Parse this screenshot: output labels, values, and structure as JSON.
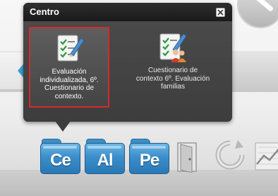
{
  "popup": {
    "title": "Centro",
    "close_icon": "close-icon",
    "options": [
      {
        "label": "Evaluación individualizada, 6º. Cuestionario de contexto.",
        "icon": "checklist-pencil-icon",
        "selected": true
      },
      {
        "label": "Cuestionario de contexto 6º. Evaluación familias",
        "icon": "checklist-family-icon",
        "selected": false
      }
    ]
  },
  "dock": {
    "items": [
      {
        "label": "Ce",
        "icon": "folder-icon"
      },
      {
        "label": "Al",
        "icon": "folder-icon"
      },
      {
        "label": "Pe",
        "icon": "folder-icon"
      },
      {
        "icon": "door-exit-icon"
      },
      {
        "icon": "refresh-icon"
      },
      {
        "icon": "line-chart-icon"
      }
    ]
  },
  "colors": {
    "accent_blue": "#3b8ecb",
    "selection_red": "#d42a2a",
    "popup_bg": "#454545"
  }
}
